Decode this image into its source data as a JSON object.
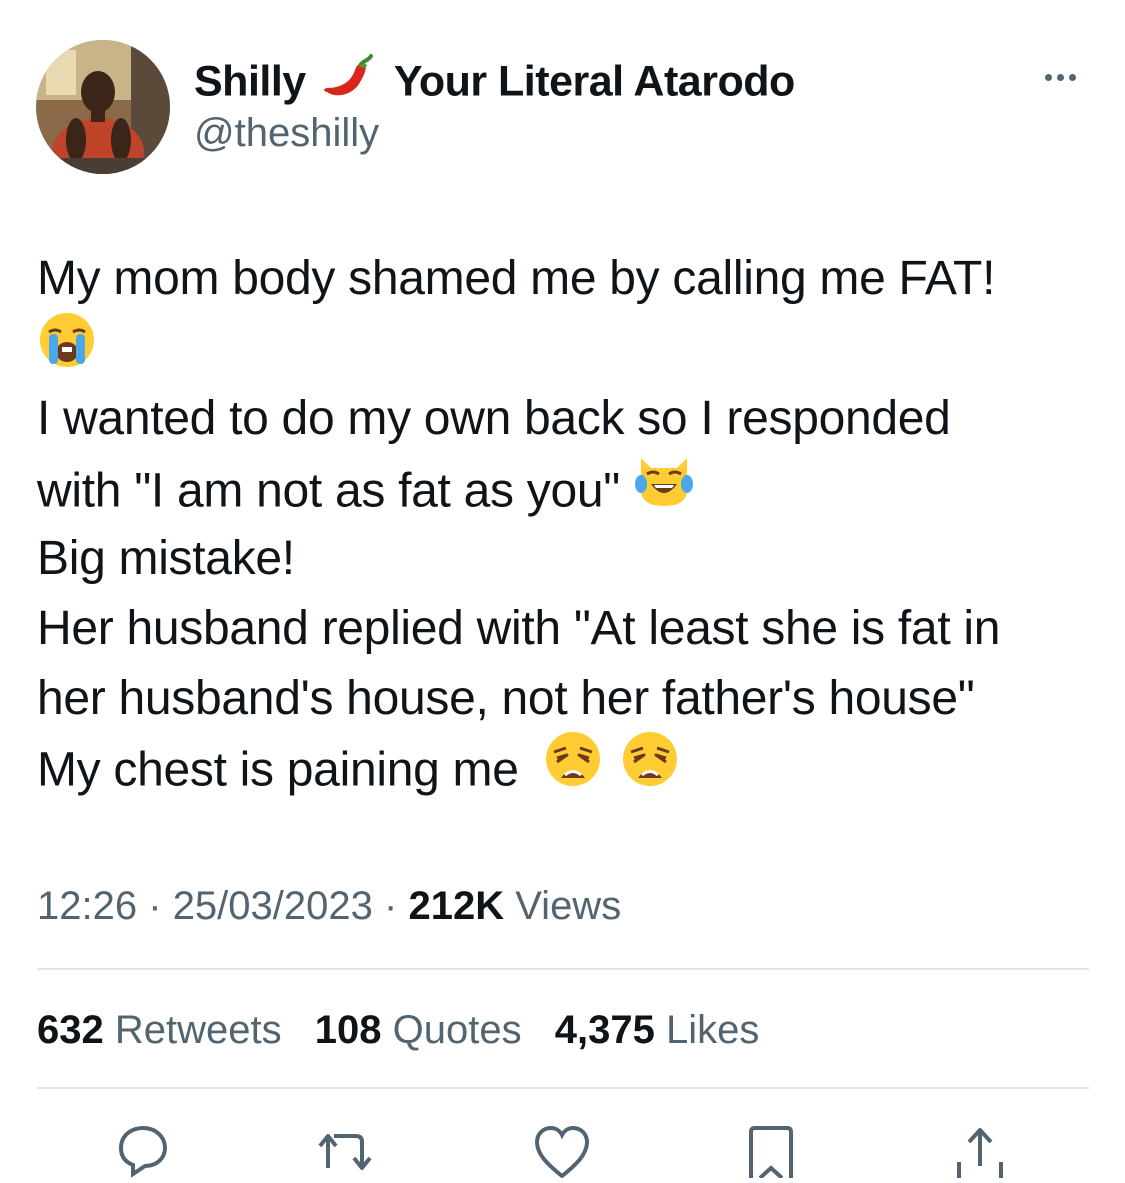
{
  "author": {
    "name_part1": "Shilly",
    "name_emoji": "chili-pepper-emoji",
    "name_part2": "Your Literal Atarodo",
    "handle": "@theshilly"
  },
  "tweet": {
    "line1": "My mom body shamed me by calling me FAT!",
    "line2_emoji": "loudly-crying-face-emoji",
    "line3": "I wanted to do my own back so I responded",
    "line4": "with \"I am not as fat as you\"",
    "line4_emoji": "cat-with-tears-of-joy-emoji",
    "line5": "Big mistake!",
    "line6": "Her husband replied with \"At least she is fat in",
    "line7": "her husband's house, not her father's house\"",
    "line8": "My chest is paining me",
    "line8_emojis": [
      "weary-face-emoji",
      "weary-face-emoji"
    ]
  },
  "meta": {
    "time": "12:26",
    "separator": "·",
    "date": "25/03/2023",
    "views_count": "212K",
    "views_label": "Views"
  },
  "stats": {
    "retweets_count": "632",
    "retweets_label": "Retweets",
    "quotes_count": "108",
    "quotes_label": "Quotes",
    "likes_count": "4,375",
    "likes_label": "Likes"
  },
  "actions": [
    "reply-icon",
    "retweet-icon",
    "like-icon",
    "bookmark-icon",
    "share-icon"
  ],
  "colors": {
    "text_primary": "#0f1419",
    "text_secondary": "#536471",
    "divider": "#e3e7ea"
  }
}
